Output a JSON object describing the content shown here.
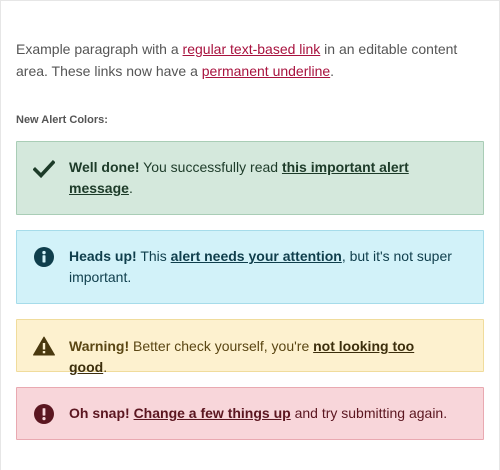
{
  "intro": {
    "text_1": "Example paragraph with a ",
    "link_1": "regular text-based link",
    "text_2": " in an editable content area. These links now have a ",
    "link_2": "permanent underline",
    "text_3": "."
  },
  "section_label": "New Alert Colors:",
  "alerts": [
    {
      "type": "success",
      "icon": "checkmark-icon",
      "title": "Well done!",
      "text_before": " You successfully read ",
      "link": "this important alert message",
      "text_after": "."
    },
    {
      "type": "info",
      "icon": "info-circle-icon",
      "title": "Heads up!",
      "text_before": " This ",
      "link": "alert needs your attention",
      "text_after": ", but it's not super important."
    },
    {
      "type": "warning",
      "icon": "warning-triangle-icon",
      "title": "Warning!",
      "text_before": " Better check yourself, you're ",
      "link": "not looking too good",
      "text_after": "."
    },
    {
      "type": "danger",
      "icon": "exclamation-circle-icon",
      "title": "Oh snap!",
      "text_before": " ",
      "link": "Change a few things up",
      "text_after": " and try submitting again."
    }
  ],
  "colors": {
    "link": "#a8123e",
    "success_bg": "#d4e8dc",
    "info_bg": "#d2f2f9",
    "warning_bg": "#fdf1cf",
    "danger_bg": "#f8d6da"
  }
}
